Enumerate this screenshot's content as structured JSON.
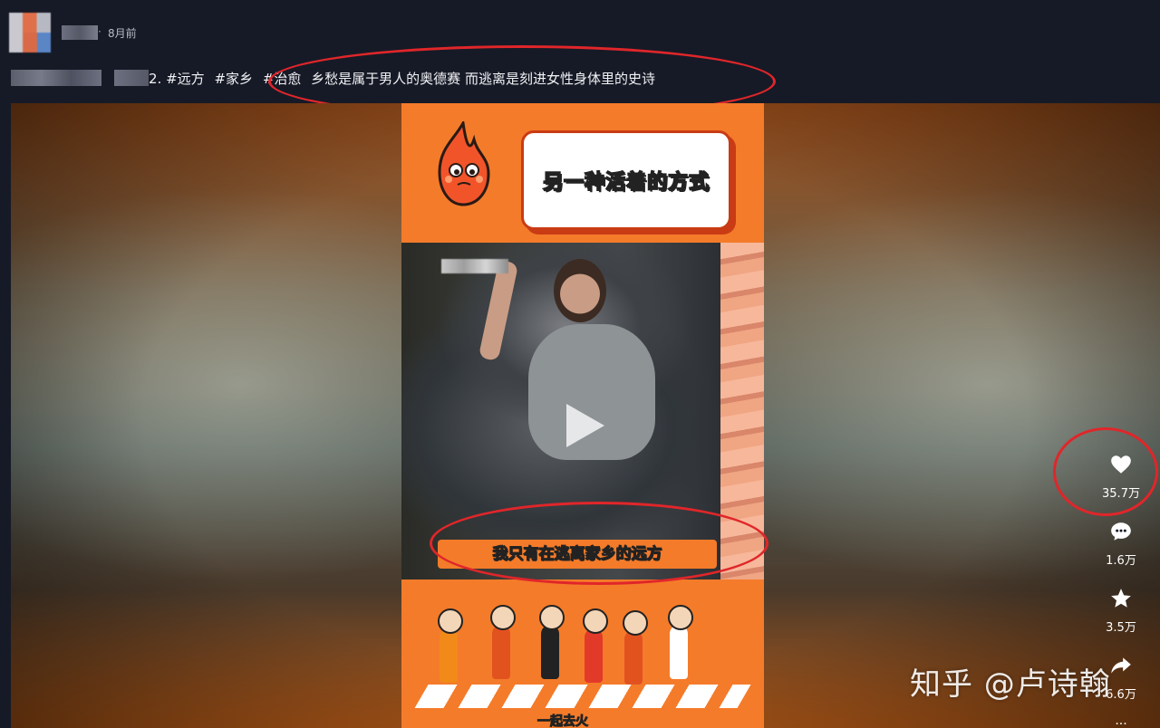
{
  "post": {
    "time": "8月前",
    "separator": "·",
    "caption_prefix_tail": "2.",
    "tags": [
      "#远方",
      "#家乡",
      "#治愈"
    ],
    "caption_text": "乡愁是属于男人的奥德赛 而逃离是刻进女性身体里的史诗"
  },
  "video": {
    "title_card": "另一种活着的方式",
    "subtitle": "我只有在逃离家乡的远方",
    "bottom_caption": "一起去火"
  },
  "actions": {
    "like_count": "35.7万",
    "comment_count": "1.6万",
    "favorite_count": "3.5万",
    "share_count": "6.6万",
    "more_label": "..."
  },
  "watermark": "知乎 @卢诗翰",
  "colors": {
    "annotation_red": "#e0262a",
    "brand_orange": "#f47b2a",
    "page_bg": "#161a26"
  }
}
